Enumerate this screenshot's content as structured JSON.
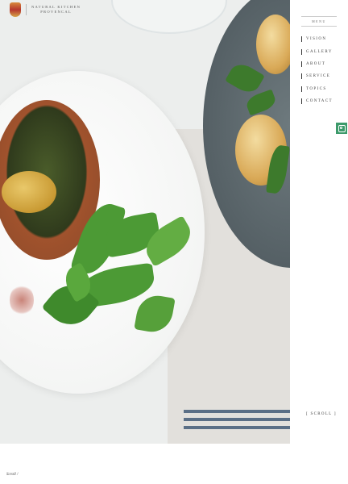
{
  "logo": {
    "line1": "NATURAL KITCHEN",
    "line2": "PROVENCAL"
  },
  "nav": {
    "menu_title": "MENU",
    "items": [
      {
        "label": "VISION"
      },
      {
        "label": "GALLERY"
      },
      {
        "label": "ABOUT"
      },
      {
        "label": "SERVICE"
      },
      {
        "label": "TOPICS"
      },
      {
        "label": "CONTACT"
      }
    ],
    "social_icon": "instagram-icon",
    "social_color": "#3d9a6b"
  },
  "scroll_label": "[ SCROLL ]",
  "footer": {
    "mark": "Scroll /"
  }
}
